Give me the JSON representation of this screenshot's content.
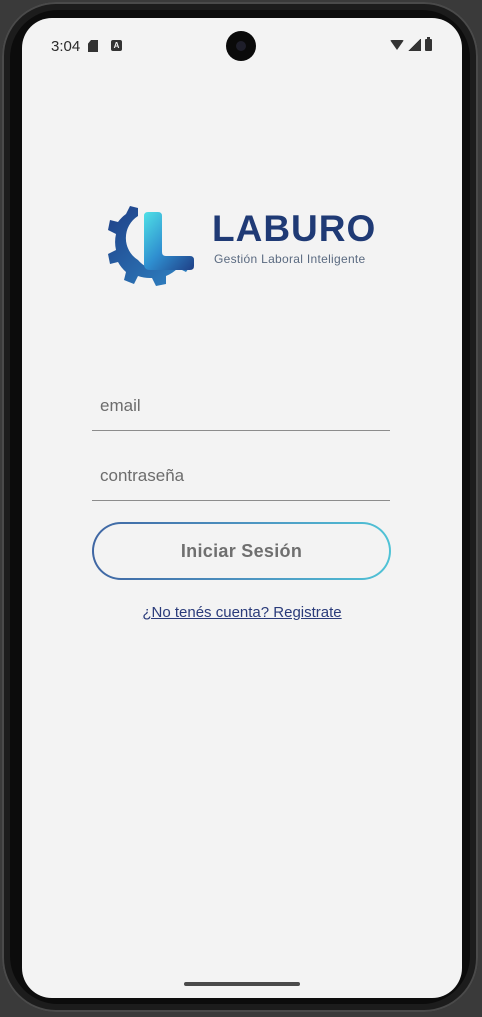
{
  "status_bar": {
    "time": "3:04",
    "icons": [
      "sd-card-icon",
      "a-badge-icon",
      "wifi-icon",
      "signal-icon",
      "battery-icon"
    ]
  },
  "brand": {
    "name": "LABURO",
    "tagline": "Gestión Laboral Inteligente",
    "colors": {
      "primary": "#1f3a75",
      "accent_start": "#2452a3",
      "accent_end": "#4fd1e0"
    }
  },
  "form": {
    "email": {
      "placeholder": "email",
      "value": ""
    },
    "password": {
      "placeholder": "contraseña",
      "value": ""
    },
    "submit_label": "Iniciar Sesión",
    "register_link": "¿No tenés cuenta? Registrate"
  },
  "colors": {
    "background": "#f3f3f3",
    "button_gradient_start": "#3f66a3",
    "button_gradient_end": "#4fc3d6",
    "link": "#2a3b7a"
  }
}
